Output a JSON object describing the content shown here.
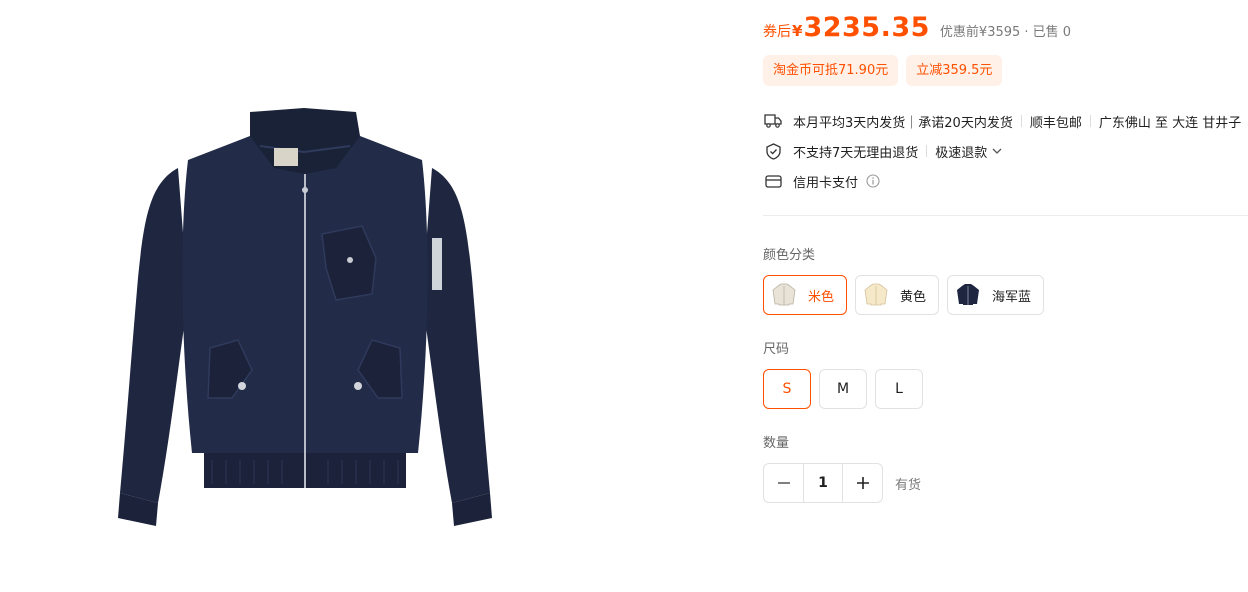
{
  "price": {
    "coupon_label": "券后",
    "currency": "¥",
    "final": "3235.35",
    "original": "优惠前¥3595 · 已售 0"
  },
  "promos": [
    "淘金币可抵71.90元",
    "立减359.5元"
  ],
  "services": {
    "shipping": {
      "icon": "truck-icon",
      "parts": [
        "本月平均3天内发货｜承诺20天内发货",
        "顺丰包邮",
        "广东佛山 至 大连 甘井子"
      ]
    },
    "returns": {
      "icon": "shield-icon",
      "parts": [
        "不支持7天无理由退货",
        "极速退款"
      ]
    },
    "payment": {
      "icon": "card-icon",
      "text": "信用卡支付"
    }
  },
  "color_label": "颜色分类",
  "colors": [
    {
      "name": "米色",
      "swatch": "#e8e3d6",
      "selected": true
    },
    {
      "name": "黄色",
      "swatch": "#f6e9c9",
      "selected": false
    },
    {
      "name": "海军蓝",
      "swatch": "#1e2640",
      "selected": false
    }
  ],
  "size_label": "尺码",
  "sizes": [
    {
      "label": "S",
      "selected": true
    },
    {
      "label": "M",
      "selected": false
    },
    {
      "label": "L",
      "selected": false
    }
  ],
  "quantity_label": "数量",
  "quantity": "1",
  "stock_status": "有货",
  "theme": {
    "accent": "#ff5000",
    "jacket": "#1e2640"
  }
}
